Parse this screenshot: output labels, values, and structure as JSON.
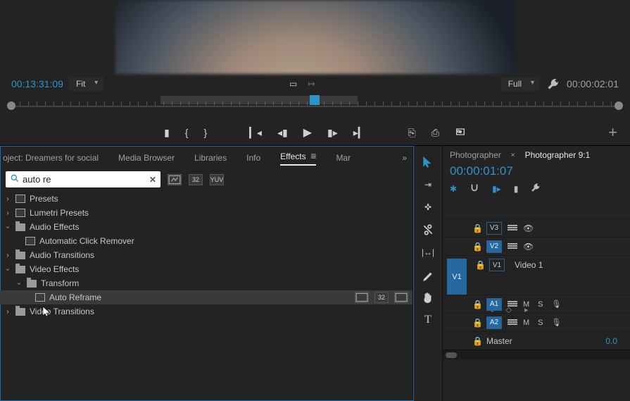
{
  "monitor": {
    "left_tc": "00:13:31:09",
    "right_tc": "00:00:02:01",
    "zoom": "Fit",
    "playback_res": "Full"
  },
  "lower_tabs": {
    "project": "oject: Dreamers for social",
    "media_browser": "Media Browser",
    "libraries": "Libraries",
    "info": "Info",
    "effects": "Effects",
    "markers": "Mar"
  },
  "search": {
    "value": "auto re",
    "badge_32": "32",
    "badge_yuv": "YUV"
  },
  "tree": {
    "presets": "Presets",
    "lumetri": "Lumetri Presets",
    "audio_fx": "Audio Effects",
    "auto_click": "Automatic Click Remover",
    "audio_trans": "Audio Transitions",
    "video_fx": "Video Effects",
    "transform": "Transform",
    "auto_reframe": "Auto Reframe",
    "video_trans": "Video Transitions"
  },
  "timeline": {
    "tab1": "Photographer",
    "tab2": "Photographer 9:1",
    "tc": "00:00:01:07",
    "tracks": {
      "v3": "V3",
      "v2": "V2",
      "v1_src": "V1",
      "v1": "V1",
      "clip": "Video 1",
      "a1": "A1",
      "a2": "A2",
      "master": "Master",
      "master_val": "0.0",
      "m": "M",
      "s": "S"
    }
  }
}
